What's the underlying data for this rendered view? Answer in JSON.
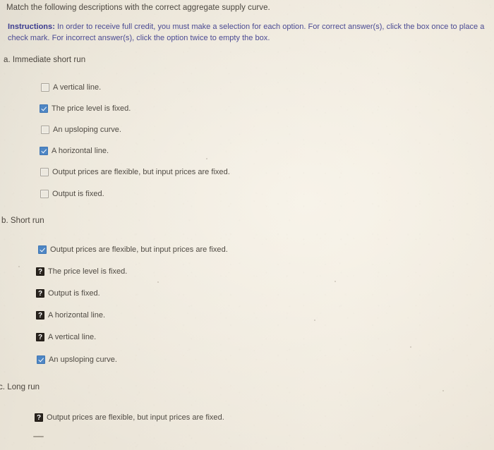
{
  "page": {
    "background_color": "#ebe5d9",
    "prompt": "Match the following descriptions with the correct aggregate supply curve.",
    "instructions_label": "Instructions:",
    "instructions_text": " In order to receive full credit, you must make a selection for each option. For correct answer(s), click the box once to place a check mark. For incorrect answer(s), click the option twice to empty the box."
  },
  "colors": {
    "checked": "#4e86c4",
    "unknown": "#2a241e",
    "empty_border": "#a9a49a",
    "instructions": "#4a4a93",
    "body_text": "#4f4a43"
  },
  "sections": [
    {
      "label": "a. Immediate short run",
      "options": [
        {
          "text": "A vertical line.",
          "state": "empty"
        },
        {
          "text": "The price level is fixed.",
          "state": "checked"
        },
        {
          "text": "An upsloping curve.",
          "state": "empty"
        },
        {
          "text": "A horizontal line.",
          "state": "checked"
        },
        {
          "text": "Output prices are flexible, but input prices are fixed.",
          "state": "empty"
        },
        {
          "text": "Output is fixed.",
          "state": "empty"
        }
      ]
    },
    {
      "label": "b. Short run",
      "options": [
        {
          "text": "Output prices are flexible, but input prices are fixed.",
          "state": "checked"
        },
        {
          "text": "The price level is fixed.",
          "state": "question"
        },
        {
          "text": "Output is fixed.",
          "state": "question"
        },
        {
          "text": "A horizontal line.",
          "state": "question"
        },
        {
          "text": "A vertical line.",
          "state": "question"
        },
        {
          "text": "An upsloping curve.",
          "state": "checked"
        }
      ]
    },
    {
      "label": "c. Long run",
      "options": [
        {
          "text": "Output prices are flexible, but input prices are fixed.",
          "state": "question"
        }
      ]
    }
  ]
}
